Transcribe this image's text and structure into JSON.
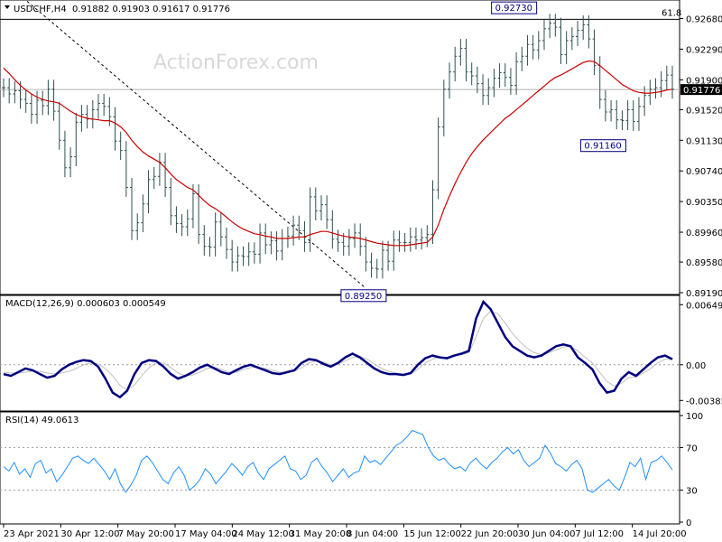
{
  "chart_data": [
    {
      "type": "candlestick",
      "title": "USDCHF,H4",
      "ohlc_label": "0.91882 0.91903 0.91617 0.91776",
      "ohlc": {
        "open": 0.91882,
        "high": 0.91903,
        "low": 0.91617,
        "close": 0.91776
      },
      "watermark": "ActionForex.com",
      "ylim": [
        0.8919,
        0.9287
      ],
      "yticks": [
        "0.92680",
        "0.92290",
        "0.91900",
        "0.91520",
        "0.91130",
        "0.90740",
        "0.90350",
        "0.89960",
        "0.89580",
        "0.89190"
      ],
      "current_price": "0.91776",
      "fib_label": "61.8",
      "fib_level": 0.9267,
      "annotations": [
        {
          "text": "0.92730",
          "value": 0.9273
        },
        {
          "text": "0.91160",
          "value": 0.9116
        },
        {
          "text": "0.89250",
          "value": 0.8925
        }
      ],
      "ma_color": "#cc0000",
      "bar_color": "#2f4f4f",
      "close_series": [
        0.918,
        0.9172,
        0.9176,
        0.9165,
        0.916,
        0.9146,
        0.9164,
        0.9157,
        0.9178,
        0.915,
        0.9113,
        0.9078,
        0.9092,
        0.9136,
        0.9146,
        0.914,
        0.9152,
        0.916,
        0.9156,
        0.9143,
        0.9112,
        0.91,
        0.9053,
        0.8998,
        0.9008,
        0.9032,
        0.9063,
        0.9067,
        0.9085,
        0.9053,
        0.9017,
        0.9007,
        0.9003,
        0.9013,
        0.9045,
        0.8993,
        0.8978,
        0.8977,
        0.9009,
        0.899,
        0.8974,
        0.8958,
        0.8966,
        0.8965,
        0.8971,
        0.8968,
        0.8995,
        0.898,
        0.8985,
        0.8972,
        0.8988,
        0.8991,
        0.9005,
        0.8998,
        0.8983,
        0.9041,
        0.9023,
        0.9031,
        0.9012,
        0.8987,
        0.8983,
        0.8978,
        0.8988,
        0.8995,
        0.8978,
        0.8958,
        0.895,
        0.8949,
        0.8973,
        0.8959,
        0.8986,
        0.8983,
        0.8983,
        0.899,
        0.8986,
        0.8989,
        0.8993,
        0.905,
        0.913,
        0.9178,
        0.92,
        0.922,
        0.923,
        0.92,
        0.9195,
        0.9185,
        0.917,
        0.918,
        0.9192,
        0.9199,
        0.9193,
        0.9183,
        0.9213,
        0.922,
        0.9235,
        0.9228,
        0.924,
        0.9255,
        0.9262,
        0.9257,
        0.9222,
        0.924,
        0.9245,
        0.9253,
        0.926,
        0.9242,
        0.9208,
        0.9165,
        0.9149,
        0.9152,
        0.9139,
        0.9138,
        0.9152,
        0.9137,
        0.9156,
        0.917,
        0.9178,
        0.918,
        0.9189,
        0.9196,
        0.9178
      ],
      "ma_series": [
        0.9205,
        0.9198,
        0.919,
        0.9183,
        0.9177,
        0.9172,
        0.9168,
        0.9165,
        0.9163,
        0.9162,
        0.916,
        0.9155,
        0.915,
        0.9146,
        0.9143,
        0.9141,
        0.914,
        0.9139,
        0.9138,
        0.9138,
        0.9135,
        0.913,
        0.9123,
        0.9113,
        0.9105,
        0.9098,
        0.9093,
        0.9089,
        0.9085,
        0.9078,
        0.907,
        0.9063,
        0.9058,
        0.9053,
        0.905,
        0.9043,
        0.9036,
        0.903,
        0.9026,
        0.9021,
        0.9015,
        0.9009,
        0.9004,
        0.9,
        0.8997,
        0.8994,
        0.8993,
        0.8991,
        0.899,
        0.8988,
        0.8988,
        0.8988,
        0.8989,
        0.899,
        0.899,
        0.8993,
        0.8995,
        0.8997,
        0.8997,
        0.8995,
        0.8993,
        0.8991,
        0.899,
        0.8989,
        0.8988,
        0.8986,
        0.8984,
        0.8982,
        0.8981,
        0.898,
        0.8979,
        0.8979,
        0.8979,
        0.898,
        0.8981,
        0.8982,
        0.8983,
        0.899,
        0.9005,
        0.9025,
        0.9042,
        0.9058,
        0.9072,
        0.9085,
        0.9096,
        0.9105,
        0.9113,
        0.912,
        0.9127,
        0.9134,
        0.9141,
        0.9146,
        0.9152,
        0.9158,
        0.9164,
        0.917,
        0.9176,
        0.9182,
        0.9188,
        0.9193,
        0.9196,
        0.92,
        0.9204,
        0.9208,
        0.9212,
        0.9214,
        0.9213,
        0.9208,
        0.9202,
        0.9196,
        0.919,
        0.9184,
        0.918,
        0.9176,
        0.9174,
        0.9173,
        0.9173,
        0.9174,
        0.9175,
        0.9177,
        0.9178
      ]
    },
    {
      "type": "line",
      "title": "MACD(12,26,9) 0.000603 0.000549",
      "ylim": [
        -0.0048,
        0.0072
      ],
      "yticks": [
        "0.00649",
        "0.00",
        "-0.003855"
      ],
      "macd_color": "#000080",
      "signal_color": "#c0c0c0",
      "macd_series": [
        -0.001,
        -0.0012,
        -0.0008,
        -0.0004,
        -0.0006,
        -0.001,
        -0.0014,
        -0.0012,
        -0.0005,
        0.0,
        0.0003,
        0.0005,
        0.0004,
        -0.0002,
        -0.0015,
        -0.003,
        -0.0035,
        -0.0028,
        -0.001,
        0.0002,
        0.0005,
        0.0004,
        -0.0002,
        -0.001,
        -0.0015,
        -0.0012,
        -0.0008,
        -0.0003,
        0.0,
        -0.0004,
        -0.0008,
        -0.001,
        -0.0006,
        -0.0002,
        0.0,
        -0.0003,
        -0.0006,
        -0.0009,
        -0.001,
        -0.0008,
        -0.0006,
        0.0002,
        0.0006,
        0.0005,
        0.0001,
        -0.0002,
        0.0002,
        0.0008,
        0.0012,
        0.0008,
        0.0002,
        -0.0004,
        -0.0008,
        -0.001,
        -0.001,
        -0.0011,
        -0.0009,
        0.0,
        0.0007,
        0.001,
        0.0008,
        0.0007,
        0.001,
        0.0012,
        0.0015,
        0.005,
        0.0068,
        0.006,
        0.0045,
        0.003,
        0.002,
        0.0015,
        0.001,
        0.0008,
        0.001,
        0.0015,
        0.002,
        0.0022,
        0.002,
        0.0008,
        0.0002,
        -0.0005,
        -0.002,
        -0.003,
        -0.0028,
        -0.0015,
        -0.0008,
        -0.0012,
        -0.0005,
        0.0002,
        0.0008,
        0.001,
        0.0006
      ],
      "signal_series": [
        -0.0008,
        -0.0009,
        -0.0009,
        -0.0008,
        -0.0007,
        -0.0007,
        -0.0009,
        -0.001,
        -0.0009,
        -0.0007,
        -0.0004,
        0.0,
        0.0002,
        0.0001,
        -0.0004,
        -0.0012,
        -0.0022,
        -0.0027,
        -0.0022,
        -0.0012,
        -0.0003,
        0.0002,
        0.0002,
        -0.0003,
        -0.0009,
        -0.0012,
        -0.0011,
        -0.0008,
        -0.0004,
        -0.0003,
        -0.0005,
        -0.0008,
        -0.0008,
        -0.0005,
        -0.0003,
        -0.0003,
        -0.0004,
        -0.0006,
        -0.0008,
        -0.0008,
        -0.0007,
        -0.0003,
        0.0002,
        0.0004,
        0.0003,
        0.0,
        0.0001,
        0.0004,
        0.0008,
        0.0009,
        0.0006,
        0.0001,
        -0.0004,
        -0.0007,
        -0.0009,
        -0.001,
        -0.001,
        -0.0005,
        0.0002,
        0.0006,
        0.0008,
        0.0008,
        0.0009,
        0.0011,
        0.0013,
        0.003,
        0.005,
        0.0058,
        0.0055,
        0.0045,
        0.0034,
        0.0025,
        0.0018,
        0.0013,
        0.0011,
        0.0013,
        0.0016,
        0.0019,
        0.002,
        0.0015,
        0.0008,
        0.0002,
        -0.0008,
        -0.0018,
        -0.0023,
        -0.002,
        -0.0014,
        -0.0013,
        -0.0009,
        -0.0004,
        0.0002,
        0.0006,
        0.0006
      ]
    },
    {
      "type": "line",
      "title": "RSI(14) 49.0613",
      "ylim": [
        0,
        100
      ],
      "yticks": [
        "100",
        "70",
        "30",
        "0"
      ],
      "levels": [
        70,
        30
      ],
      "rsi_color": "#1e90ff",
      "rsi_series": [
        52,
        48,
        56,
        45,
        50,
        42,
        55,
        58,
        46,
        50,
        38,
        44,
        52,
        60,
        62,
        58,
        55,
        60,
        54,
        48,
        40,
        50,
        36,
        28,
        35,
        44,
        58,
        62,
        56,
        48,
        40,
        36,
        46,
        52,
        44,
        30,
        34,
        40,
        50,
        45,
        36,
        42,
        48,
        55,
        50,
        44,
        52,
        56,
        46,
        40,
        50,
        54,
        58,
        62,
        50,
        48,
        40,
        44,
        56,
        60,
        52,
        46,
        38,
        44,
        50,
        42,
        46,
        48,
        62,
        56,
        58,
        54,
        60,
        66,
        72,
        75,
        80,
        86,
        84,
        82,
        70,
        62,
        58,
        60,
        54,
        50,
        52,
        48,
        56,
        60,
        54,
        50,
        56,
        60,
        66,
        70,
        64,
        68,
        58,
        52,
        56,
        60,
        72,
        65,
        55,
        52,
        48,
        54,
        58,
        50,
        30,
        28,
        32,
        36,
        40,
        34,
        30,
        42,
        56,
        52,
        60,
        40,
        56,
        58,
        62,
        56,
        49
      ]
    },
    {
      "type": "axis",
      "x_tick_labels": [
        "23 Apr 2021",
        "30 Apr 12:00",
        "7 May 20:00",
        "17 May 04:00",
        "24 May 12:00",
        "31 May 20:00",
        "8 Jun 04:00",
        "15 Jun 12:00",
        "22 Jun 20:00",
        "30 Jun 04:00",
        "7 Jul 12:00",
        "14 Jul 20:00"
      ]
    }
  ]
}
